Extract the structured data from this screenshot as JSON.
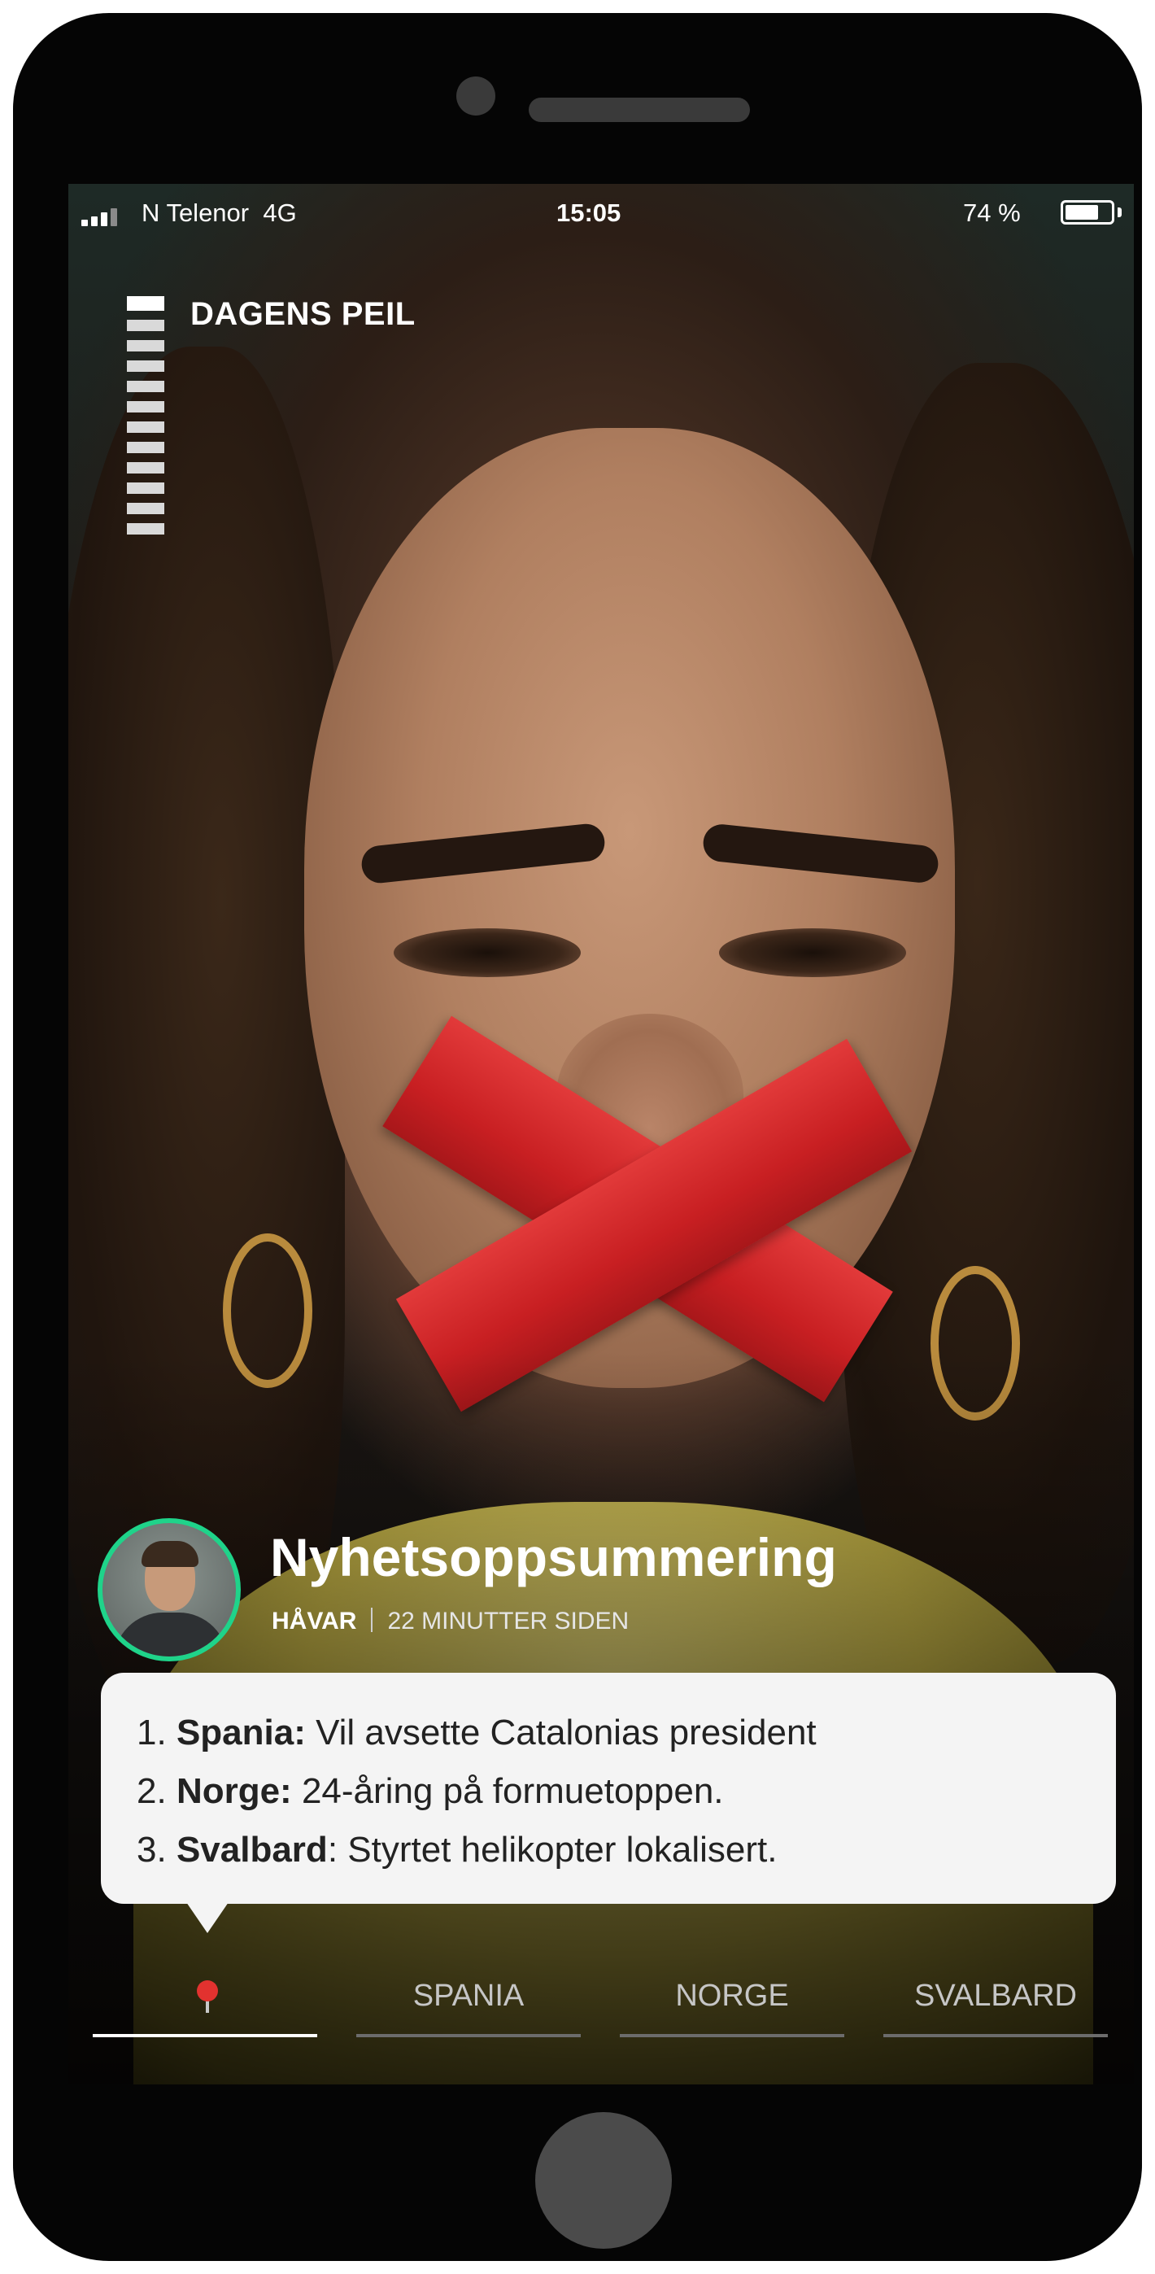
{
  "status_bar": {
    "carrier": "N Telenor",
    "network": "4G",
    "time": "15:05",
    "battery": "74 %",
    "battery_level": 0.74
  },
  "story": {
    "section_label": "DAGENS PEIL",
    "segment_count": 12
  },
  "article": {
    "title": "Nyhetsoppsummering",
    "author": "HÅVAR",
    "timestamp": "22 MINUTTER SIDEN"
  },
  "summary": {
    "items": [
      {
        "number": "1.",
        "topic": "Spania:",
        "text": "Vil avsette Catalonias president"
      },
      {
        "number": "2.",
        "topic": "Norge:",
        "text": "24-åring på formuetoppen."
      },
      {
        "number": "3.",
        "topic": "Svalbard",
        "text": ": Styrtet helikopter lokalisert."
      }
    ]
  },
  "tabs": {
    "icon": "map-pin-icon",
    "items": [
      "SPANIA",
      "NORGE",
      "SVALBARD"
    ]
  },
  "colors": {
    "avatar_ring": "#1fd38a",
    "pin": "#e2322f",
    "tape": "#d12a2c"
  }
}
